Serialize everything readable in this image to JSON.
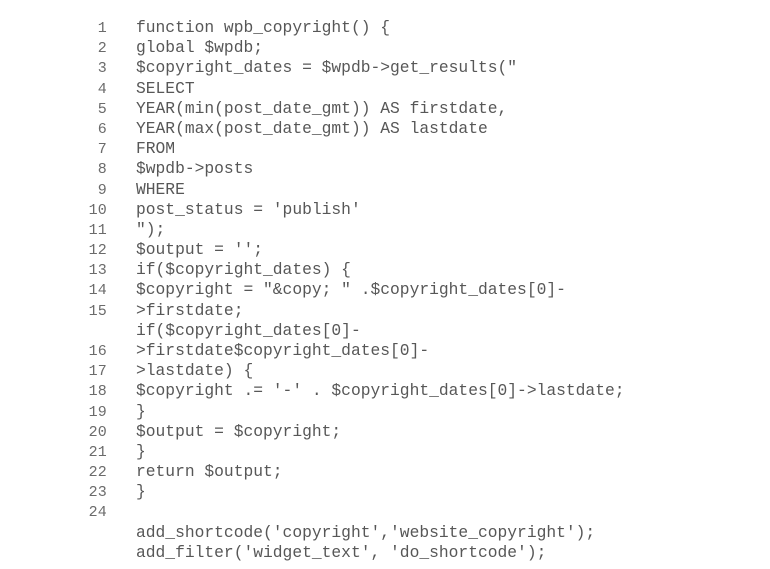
{
  "code_block": {
    "language": "php",
    "background_color": "#ffffff",
    "text_color": "#575757",
    "line_number_color": "#6b6b6b",
    "lines": [
      {
        "number": "1",
        "text": "function wpb_copyright() {"
      },
      {
        "number": "2",
        "text": "global $wpdb;"
      },
      {
        "number": "3",
        "text": "$copyright_dates = $wpdb->get_results(\""
      },
      {
        "number": "4",
        "text": "SELECT"
      },
      {
        "number": "5",
        "text": "YEAR(min(post_date_gmt)) AS firstdate,"
      },
      {
        "number": "6",
        "text": "YEAR(max(post_date_gmt)) AS lastdate"
      },
      {
        "number": "7",
        "text": "FROM"
      },
      {
        "number": "8",
        "text": "$wpdb->posts"
      },
      {
        "number": "9",
        "text": "WHERE"
      },
      {
        "number": "10",
        "text": "post_status = 'publish'"
      },
      {
        "number": "11",
        "text": "\");"
      },
      {
        "number": "12",
        "text": "$output = '';"
      },
      {
        "number": "13",
        "text": "if($copyright_dates) {"
      },
      {
        "number": "14",
        "text": "$copyright = \"&copy; \" .$copyright_dates[0]-"
      },
      {
        "number": "15",
        "text": ">firstdate;"
      },
      {
        "number": "",
        "text": "if($copyright_dates[0]-"
      },
      {
        "number": "16",
        "text": ">firstdate$copyright_dates[0]-"
      },
      {
        "number": "17",
        "text": ">lastdate) {"
      },
      {
        "number": "18",
        "text": "$copyright .= '-' . $copyright_dates[0]->lastdate;"
      },
      {
        "number": "19",
        "text": "}"
      },
      {
        "number": "20",
        "text": "$output = $copyright;"
      },
      {
        "number": "21",
        "text": "}"
      },
      {
        "number": "22",
        "text": "return $output;"
      },
      {
        "number": "23",
        "text": "}"
      },
      {
        "number": "24",
        "text": ""
      },
      {
        "number": "",
        "text": "add_shortcode('copyright','website_copyright');"
      },
      {
        "number": "",
        "text": "add_filter('widget_text', 'do_shortcode');"
      }
    ]
  }
}
